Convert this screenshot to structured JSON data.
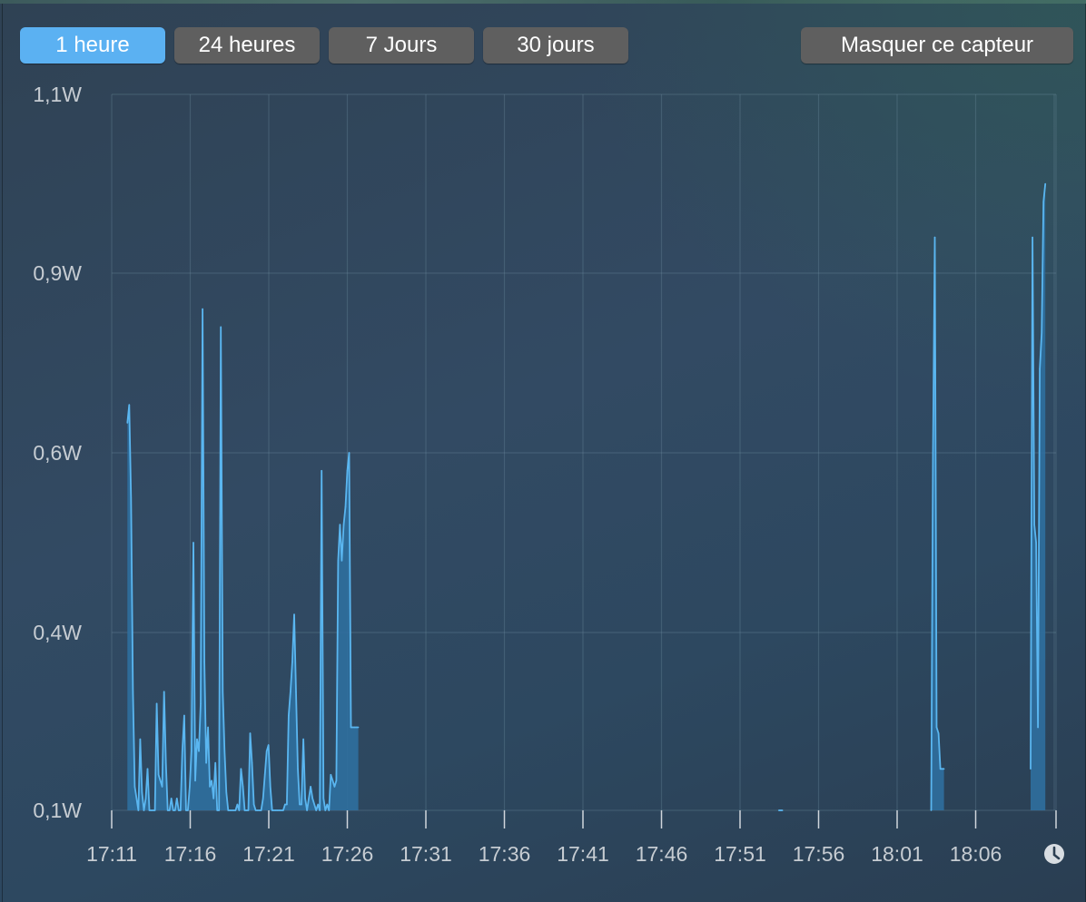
{
  "toolbar": {
    "buttons": [
      {
        "label": "1 heure",
        "active": true
      },
      {
        "label": "24 heures",
        "active": false
      },
      {
        "label": "7 Jours",
        "active": false
      },
      {
        "label": "30 jours",
        "active": false
      }
    ],
    "hide_label": "Masquer ce capteur"
  },
  "icons": {
    "clock": "clock-icon"
  },
  "colors": {
    "accent": "#5bb1f2",
    "button": "#5f5f5f",
    "line": "#5ab6f0",
    "fill": "#2f6f9f"
  },
  "chart_data": {
    "type": "area",
    "title": "",
    "xlabel": "",
    "ylabel": "",
    "y_ticks": [
      "1,1W",
      "0,9W",
      "0,6W",
      "0,4W",
      "0,1W"
    ],
    "y_tick_values": [
      1.1,
      0.9,
      0.6,
      0.4,
      0.1
    ],
    "x_ticks": [
      "17:11",
      "17:16",
      "17:21",
      "17:26",
      "17:31",
      "17:36",
      "17:41",
      "17:46",
      "17:51",
      "17:56",
      "18:01",
      "18:06"
    ],
    "grid": true,
    "series": [
      {
        "x": [
          "17:12:00",
          "17:12:07",
          "17:12:14",
          "17:12:21",
          "17:12:28",
          "17:12:35",
          "17:12:42",
          "17:12:49",
          "17:12:56",
          "17:13:03",
          "17:13:10",
          "17:13:17",
          "17:13:24",
          "17:13:31",
          "17:13:38",
          "17:13:45",
          "17:13:52",
          "17:13:59",
          "17:14:06",
          "17:14:13",
          "17:14:20",
          "17:14:27",
          "17:14:34",
          "17:14:41",
          "17:14:48",
          "17:14:55",
          "17:15:02",
          "17:15:09",
          "17:15:16",
          "17:15:23",
          "17:15:30",
          "17:15:37",
          "17:15:44",
          "17:15:51",
          "17:15:58",
          "17:16:05",
          "17:16:12",
          "17:16:19",
          "17:16:26",
          "17:16:33",
          "17:16:40",
          "17:16:47",
          "17:16:54",
          "17:17:01",
          "17:17:08",
          "17:17:15",
          "17:17:22",
          "17:17:29",
          "17:17:36",
          "17:17:43",
          "17:17:50",
          "17:17:57",
          "17:18:04",
          "17:18:11",
          "17:18:18",
          "17:18:25",
          "17:18:32",
          "17:18:39",
          "17:18:46",
          "17:18:53",
          "17:19:00",
          "17:19:07",
          "17:19:14",
          "17:19:21",
          "17:19:28",
          "17:19:35",
          "17:19:42",
          "17:19:49",
          "17:19:56",
          "17:20:03",
          "17:20:10",
          "17:20:17",
          "17:20:24",
          "17:20:31",
          "17:20:38",
          "17:20:45",
          "17:20:52",
          "17:20:59",
          "17:21:06",
          "17:21:13",
          "17:21:20",
          "17:21:27",
          "17:21:34",
          "17:21:41",
          "17:21:48",
          "17:21:55",
          "17:22:02",
          "17:22:09",
          "17:22:16",
          "17:22:23",
          "17:22:30",
          "17:22:37",
          "17:22:44",
          "17:22:51",
          "17:22:58",
          "17:23:05",
          "17:23:12",
          "17:23:19",
          "17:23:26",
          "17:23:33",
          "17:23:40",
          "17:23:47",
          "17:23:54",
          "17:24:01",
          "17:24:08",
          "17:24:15",
          "17:24:22",
          "17:24:29",
          "17:24:36",
          "17:24:43",
          "17:24:50",
          "17:24:57",
          "17:25:04",
          "17:25:11",
          "17:25:18",
          "17:25:25",
          "17:25:32",
          "17:25:39",
          "17:25:46",
          "17:25:53",
          "17:26:00",
          "17:26:07",
          "17:26:14",
          "17:26:21",
          "17:26:28",
          "17:26:35",
          "17:26:42"
        ],
        "y": [
          0.65,
          0.68,
          0.55,
          0.3,
          0.14,
          0.12,
          0.1,
          0.22,
          0.13,
          0.1,
          0.12,
          0.17,
          0.1,
          0.1,
          0.1,
          0.1,
          0.28,
          0.16,
          0.15,
          0.14,
          0.3,
          0.18,
          0.1,
          0.1,
          0.12,
          0.1,
          0.1,
          0.12,
          0.1,
          0.1,
          0.2,
          0.26,
          0.1,
          0.1,
          0.14,
          0.2,
          0.5,
          0.15,
          0.22,
          0.2,
          0.28,
          0.84,
          0.35,
          0.18,
          0.24,
          0.14,
          0.15,
          0.12,
          0.18,
          0.1,
          0.1,
          0.81,
          0.3,
          0.2,
          0.13,
          0.1,
          0.1,
          0.1,
          0.1,
          0.1,
          0.11,
          0.1,
          0.17,
          0.14,
          0.1,
          0.1,
          0.1,
          0.23,
          0.18,
          0.11,
          0.1,
          0.1,
          0.1,
          0.1,
          0.12,
          0.16,
          0.2,
          0.21,
          0.14,
          0.1,
          0.1,
          0.1,
          0.1,
          0.1,
          0.1,
          0.1,
          0.11,
          0.11,
          0.26,
          0.3,
          0.35,
          0.42,
          0.3,
          0.17,
          0.11,
          0.11,
          0.22,
          0.12,
          0.1,
          0.12,
          0.14,
          0.12,
          0.11,
          0.1,
          0.11,
          0.1,
          0.58,
          0.12,
          0.1,
          0.11,
          0.1,
          0.16,
          0.15,
          0.14,
          0.15,
          0.48,
          0.52,
          0.48,
          0.52,
          0.54,
          0.58,
          0.6,
          0.24,
          0.24,
          0.24,
          0.24,
          0.24
        ]
      },
      {
        "x": [
          "17:53:28",
          "17:53:42"
        ],
        "y": [
          0.1,
          0.1
        ]
      },
      {
        "x": [
          "18:03:10",
          "18:03:17",
          "18:03:24",
          "18:03:31",
          "18:03:38",
          "18:03:45",
          "18:03:52",
          "18:03:59"
        ],
        "y": [
          0.1,
          0.6,
          0.94,
          0.24,
          0.23,
          0.17,
          0.17,
          0.17
        ]
      },
      {
        "x": [
          "18:09:30",
          "18:09:37",
          "18:09:44",
          "18:09:51",
          "18:09:58",
          "18:10:05",
          "18:10:12",
          "18:10:19",
          "18:10:26"
        ],
        "y": [
          0.17,
          0.94,
          0.52,
          0.5,
          0.24,
          0.74,
          0.8,
          0.98,
          1.0
        ]
      }
    ]
  }
}
